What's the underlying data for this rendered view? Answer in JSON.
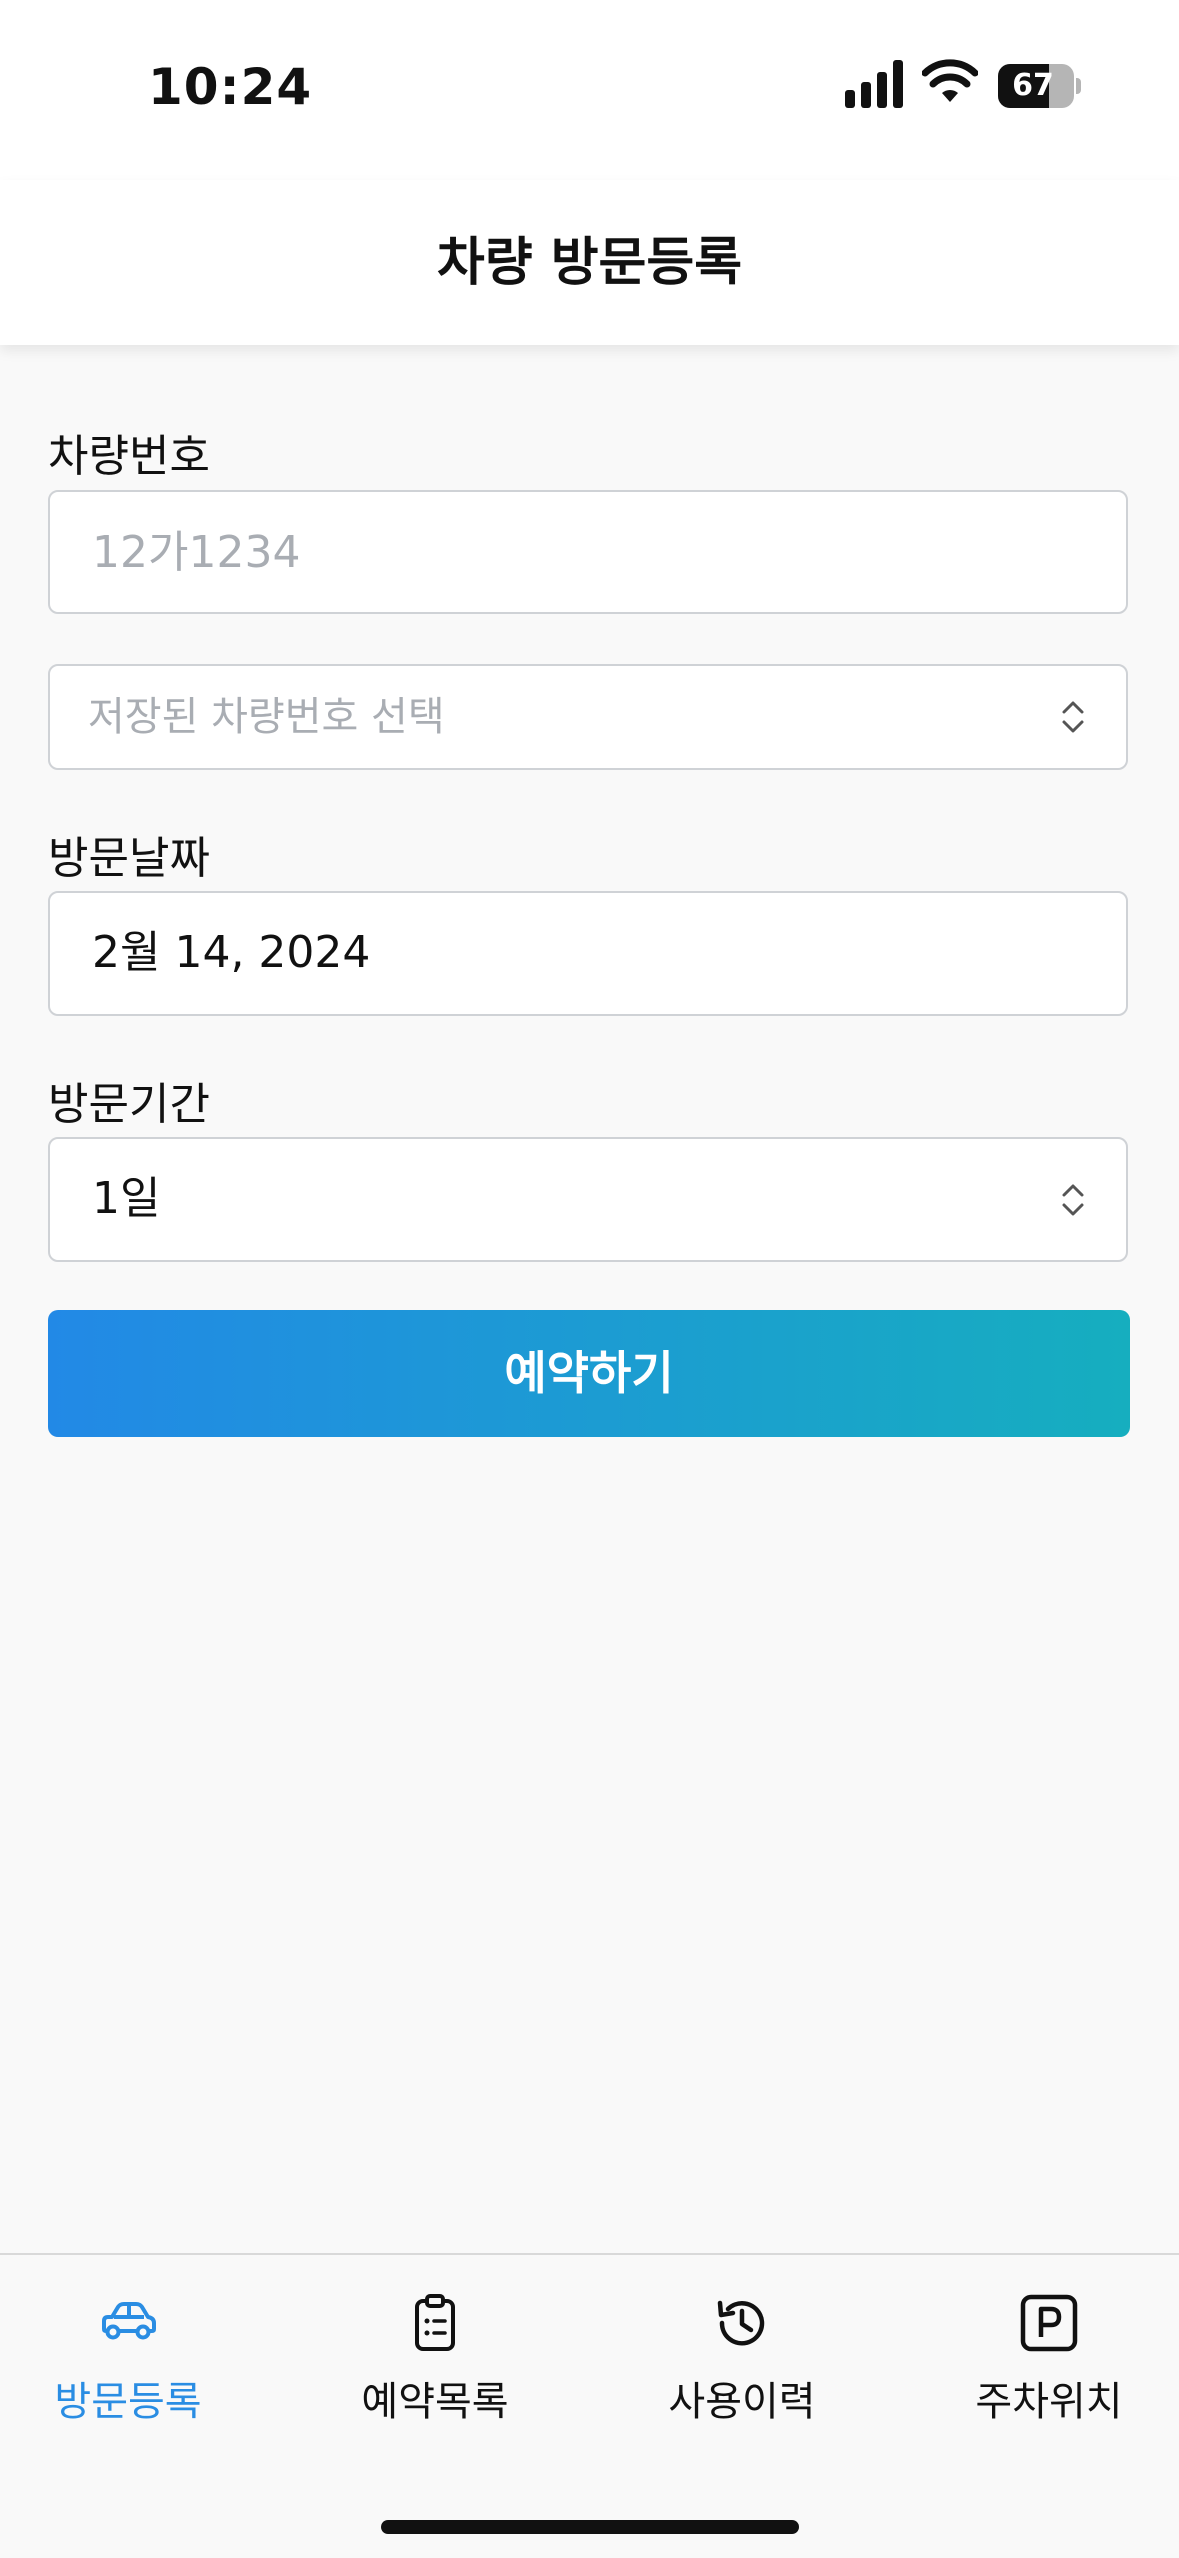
{
  "status_bar": {
    "time": "10:24",
    "battery_level": "67",
    "battery_fraction": 0.67
  },
  "header": {
    "title": "차량 방문등록"
  },
  "form": {
    "plate": {
      "label": "차량번호",
      "placeholder": "12가1234",
      "value": ""
    },
    "saved_plate": {
      "placeholder": "저장된 차량번호 선택"
    },
    "date": {
      "label": "방문날짜",
      "value": "2월 14, 2024"
    },
    "duration": {
      "label": "방문기간",
      "value": "1일"
    },
    "submit_label": "예약하기"
  },
  "tab_bar": {
    "active_color": "#2a8de3",
    "items": [
      {
        "label": "방문등록",
        "icon": "car-icon",
        "active": true
      },
      {
        "label": "예약목록",
        "icon": "clipboard-list-icon",
        "active": false
      },
      {
        "label": "사용이력",
        "icon": "history-icon",
        "active": false
      },
      {
        "label": "주차위치",
        "icon": "parking-icon",
        "active": false
      }
    ]
  },
  "colors": {
    "accent_start": "#2289e6",
    "accent_end": "#16aebf",
    "background": "#f9f9f9"
  }
}
